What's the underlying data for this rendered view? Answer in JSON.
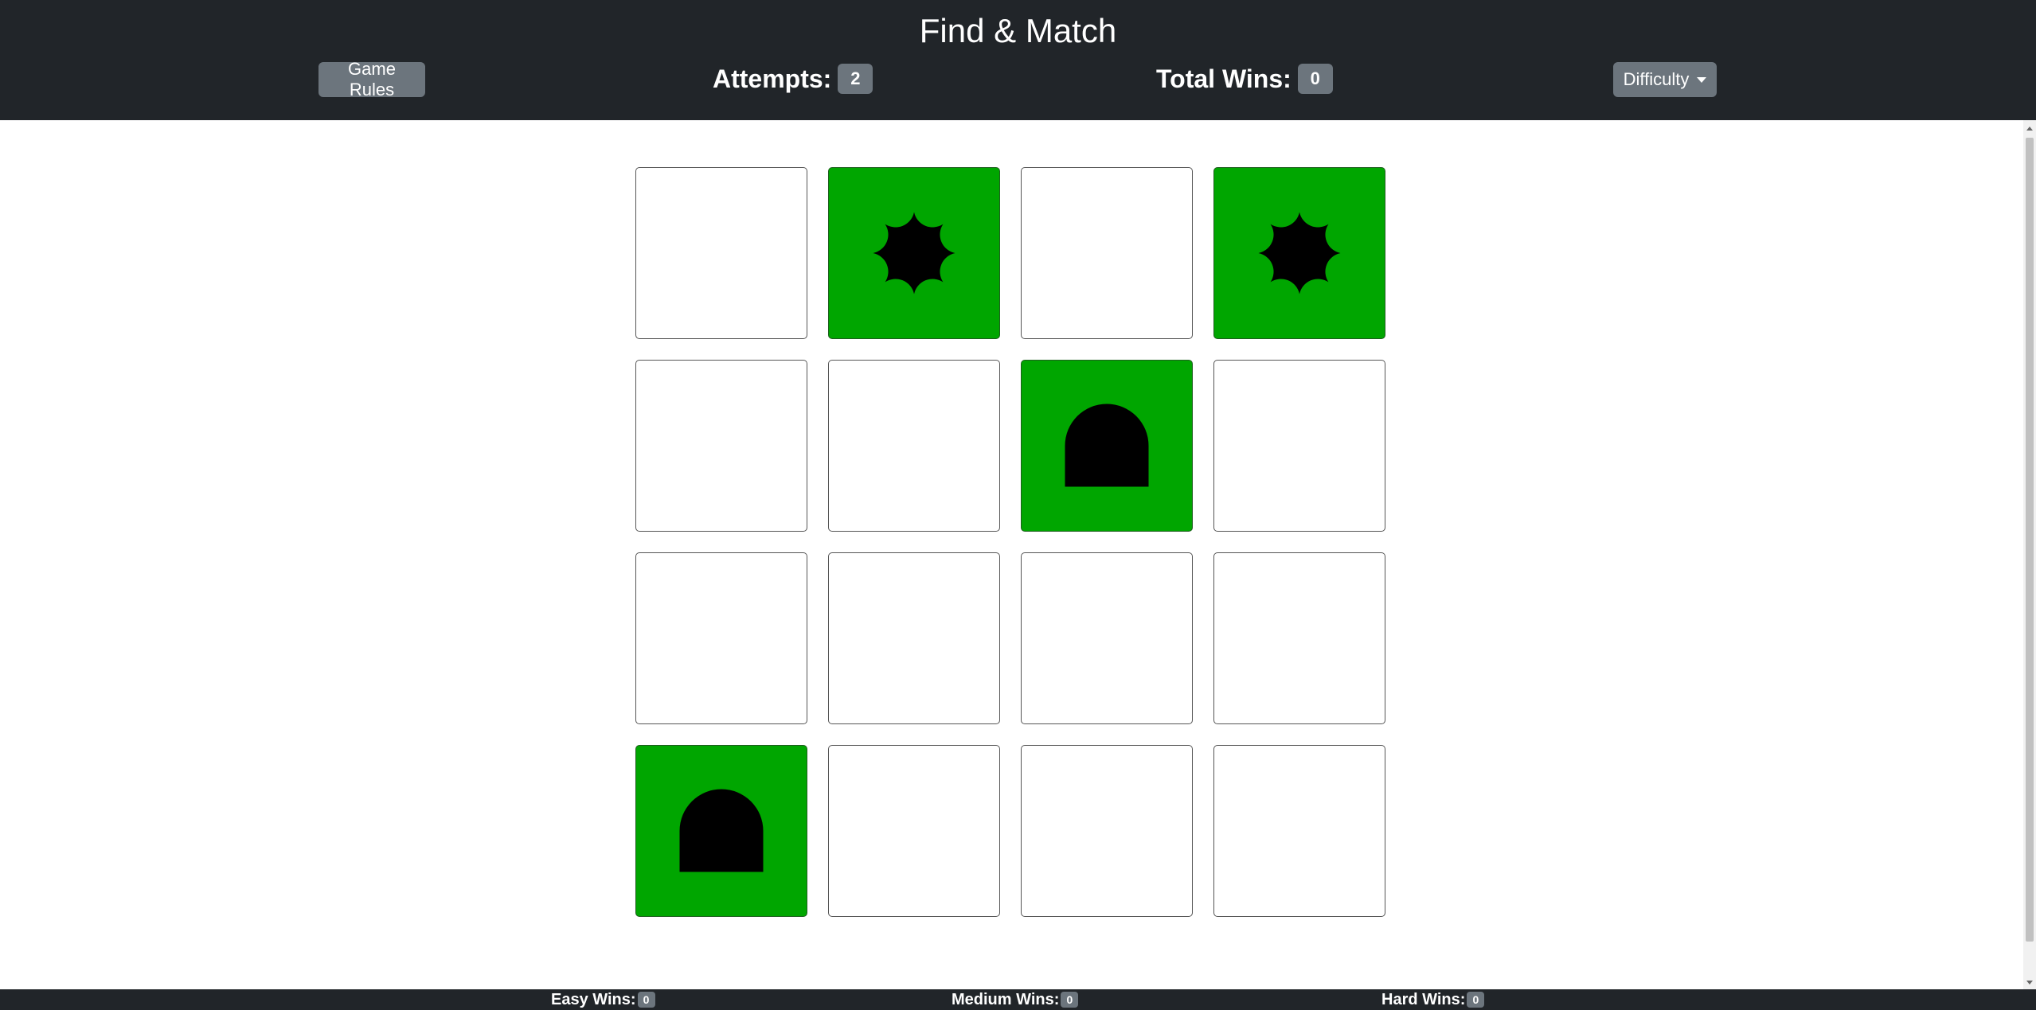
{
  "header": {
    "title": "Find & Match",
    "rules_label": "Game Rules",
    "attempts_label": "Attempts:",
    "attempts_value": "2",
    "wins_label": "Total Wins:",
    "wins_value": "0",
    "difficulty_label": "Difficulty"
  },
  "board": {
    "rows": 4,
    "cols": 4,
    "cards": [
      {
        "state": "hidden",
        "symbol": ""
      },
      {
        "state": "matched",
        "symbol": "star-burst-icon"
      },
      {
        "state": "hidden",
        "symbol": ""
      },
      {
        "state": "matched",
        "symbol": "star-burst-icon"
      },
      {
        "state": "hidden",
        "symbol": ""
      },
      {
        "state": "hidden",
        "symbol": ""
      },
      {
        "state": "matched",
        "symbol": "arch-icon"
      },
      {
        "state": "hidden",
        "symbol": ""
      },
      {
        "state": "hidden",
        "symbol": ""
      },
      {
        "state": "hidden",
        "symbol": ""
      },
      {
        "state": "hidden",
        "symbol": ""
      },
      {
        "state": "hidden",
        "symbol": ""
      },
      {
        "state": "matched",
        "symbol": "arch-icon"
      },
      {
        "state": "hidden",
        "symbol": ""
      },
      {
        "state": "hidden",
        "symbol": ""
      },
      {
        "state": "hidden",
        "symbol": ""
      }
    ]
  },
  "footer": {
    "easy_label": "Easy Wins:",
    "easy_value": "0",
    "medium_label": "Medium Wins:",
    "medium_value": "0",
    "hard_label": "Hard Wins:",
    "hard_value": "0"
  },
  "colors": {
    "header_bg": "#212529",
    "matched_card": "#00a600",
    "button_bg": "#6c757d"
  }
}
